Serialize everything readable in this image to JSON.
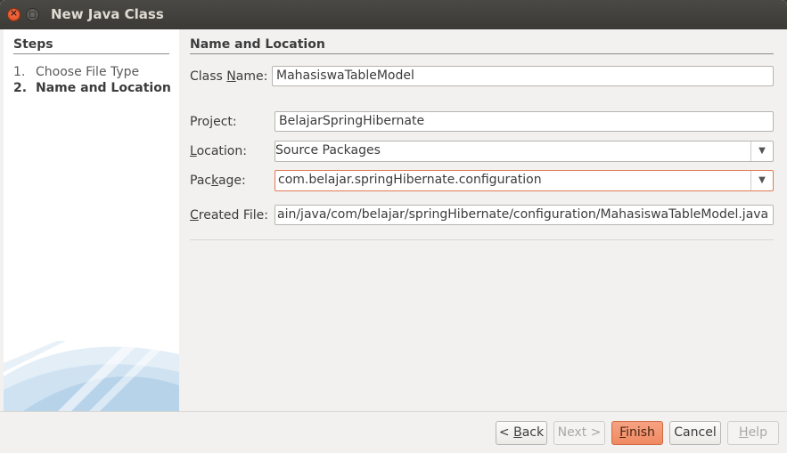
{
  "window": {
    "title": "New Java Class"
  },
  "steps": {
    "heading": "Steps",
    "items": [
      {
        "num": "1.",
        "label": "Choose File Type",
        "current": false
      },
      {
        "num": "2.",
        "label": "Name and Location",
        "current": true
      }
    ]
  },
  "main": {
    "section_title": "Name and Location",
    "class_name": {
      "label": "Class Name:",
      "value": "MahasiswaTableModel"
    },
    "project": {
      "label": "Project:",
      "value": "BelajarSpringHibernate"
    },
    "location": {
      "label": "Location:",
      "value": "Source Packages"
    },
    "package": {
      "label": "Package:",
      "value": "com.belajar.springHibernate.configuration"
    },
    "created_file": {
      "label": "Created File:",
      "value": "ain/java/com/belajar/springHibernate/configuration/MahasiswaTableModel.java"
    }
  },
  "buttons": {
    "back": "< Back",
    "next": "Next >",
    "finish": "Finish",
    "cancel": "Cancel",
    "help": "Help"
  },
  "icons": {
    "close": "close-icon",
    "minimize": "minimize-icon",
    "dropdown": "chevron-down-icon"
  },
  "colors": {
    "accent": "#ef8a62",
    "focus_border": "#e07b53"
  }
}
